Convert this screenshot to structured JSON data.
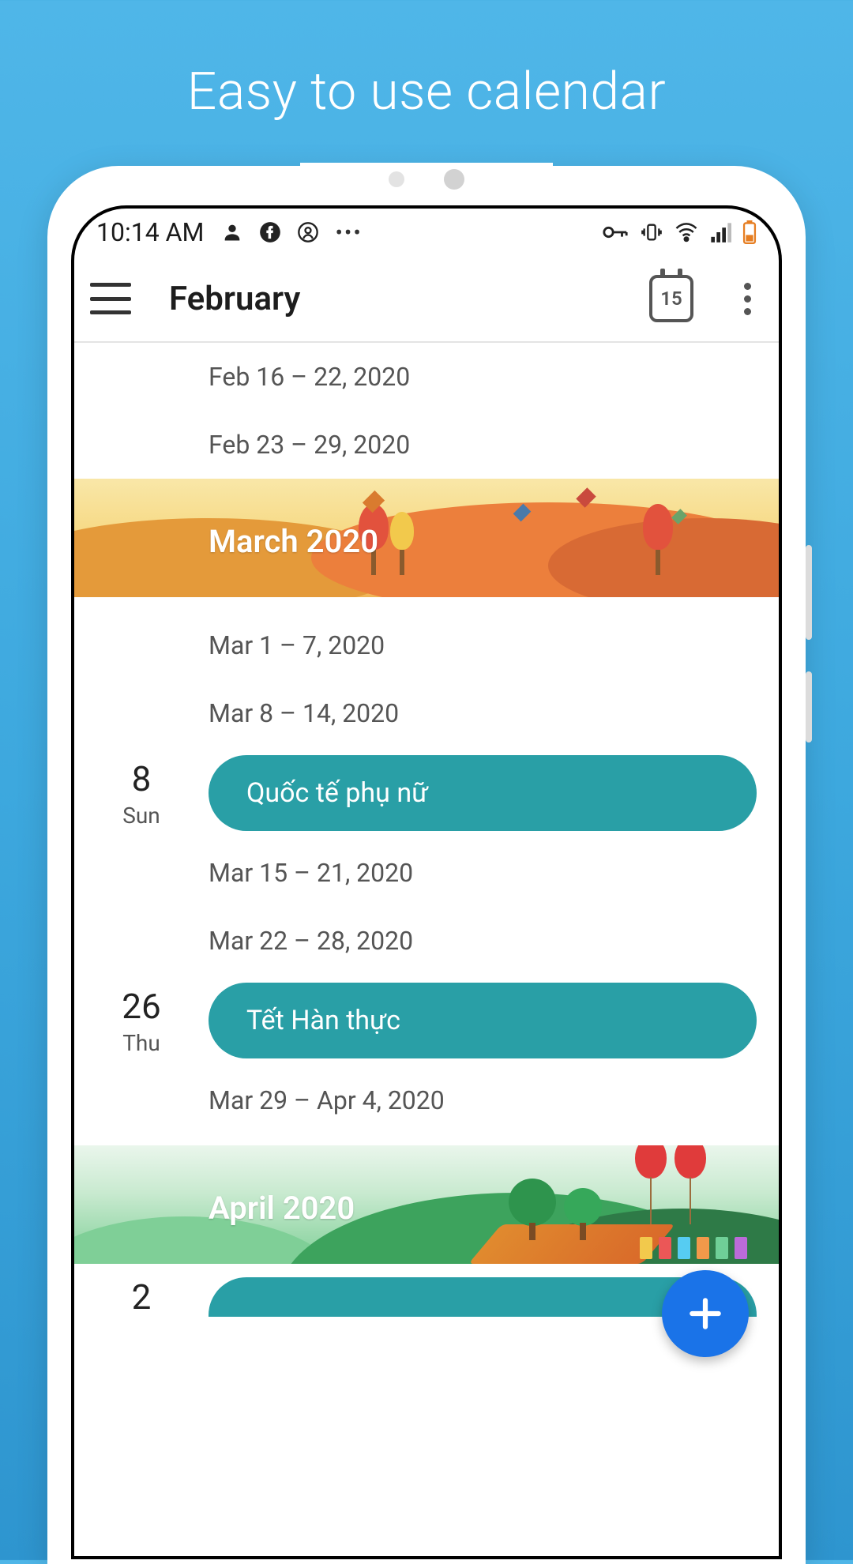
{
  "promo": {
    "title": "Easy to use calendar"
  },
  "statusbar": {
    "clock": "10:14 AM"
  },
  "appbar": {
    "title": "February",
    "today_day": "15"
  },
  "weeks_top": [
    "Feb 16 – 22, 2020",
    "Feb 23 – 29, 2020"
  ],
  "months": {
    "march": {
      "label": "March 2020"
    },
    "april": {
      "label": "April 2020"
    }
  },
  "march_weeks_a": [
    "Mar 1 – 7, 2020",
    "Mar 8 – 14, 2020"
  ],
  "march_weeks_b": [
    "Mar 15 – 21, 2020",
    "Mar 22 – 28, 2020"
  ],
  "march_weeks_c": [
    "Mar 29 – Apr 4, 2020"
  ],
  "events": {
    "e1": {
      "daynum": "8",
      "dow": "Sun",
      "title": "Quốc tế phụ nữ"
    },
    "e2": {
      "daynum": "26",
      "dow": "Thu",
      "title": "Tết Hàn thực"
    }
  },
  "peek": {
    "daynum": "2"
  },
  "colors": {
    "event": "#299fa6",
    "fab": "#1a73e8"
  }
}
